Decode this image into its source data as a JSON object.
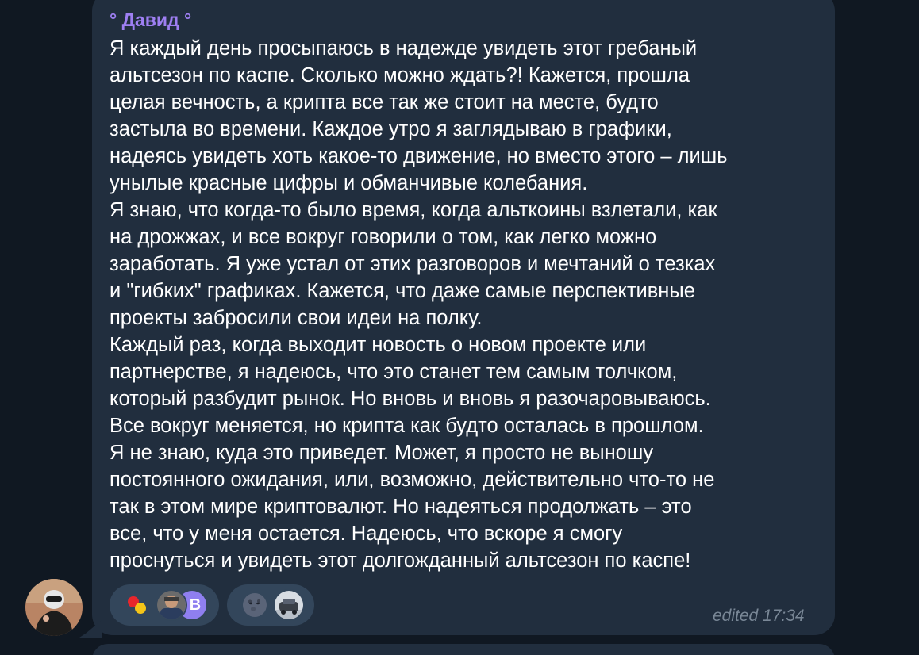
{
  "message": {
    "sender_name": "° Давид °",
    "paragraphs": [
      "Я каждый день просыпаюсь в надежде увидеть этот гребаный\nальтсезон по каспе. Сколько можно ждать?! Кажется, прошла\nцелая вечность, а крипта все так же стоит на месте, будто\nзастыла во времени. Каждое утро я заглядываю в графики,\nнадеясь увидеть хоть какое-то движение, но вместо этого – лишь\nунылые красные цифры и обманчивые колебания.",
      "Я знаю, что когда-то было время, когда альткоины взлетали, как\nна дрожжах, и все вокруг говорили о том, как легко можно\nзаработать. Я уже устал от этих разговоров и мечтаний о тезках\nи \"гибких\" графиках. Кажется, что даже самые перспективные\nпроекты забросили свои идеи на полку.",
      "Каждый раз, когда выходит новость о новом проекте или\nпартнерстве, я надеюсь, что это станет тем самым толчком,\nкоторый разбудит рынок. Но вновь и вновь я разочаровываюсь.\nВсе вокруг меняется, но крипта как будто осталась в прошлом.\nЯ не знаю, куда это приведет. Может, я просто не выношу\nпостоянного ожидания, или, возможно, действительно что-то не\nтак в этом мире криптовалют. Но надеяться продолжать – это\nвсе, что у меня остается. Надеюсь, что вскоре я смогу\nпроснуться и увидеть этот долгожданный альтсезон по каспе!"
    ],
    "timestamp": "edited 17:34"
  },
  "reactions": [
    {
      "emoji_icon": "red-yellow-dots-icon",
      "reactors": [
        "avatar-photo",
        "avatar-letter"
      ],
      "letter": "В"
    },
    {
      "emoji_icon": "new-moon-face-icon",
      "reactors": [
        "avatar-photo"
      ]
    }
  ],
  "colors": {
    "background": "#101822",
    "bubble": "#212e3e",
    "sender_name": "#9e7ff2",
    "text": "#ffffff",
    "reaction_pill": "#33465b",
    "timestamp": "#7a8897",
    "letter_avatar": "#8f7ff0"
  }
}
